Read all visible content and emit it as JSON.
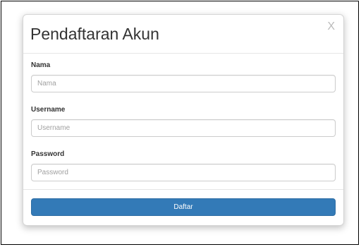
{
  "modal": {
    "title": "Pendaftaran Akun",
    "close_label": "X"
  },
  "form": {
    "fields": [
      {
        "label": "Nama",
        "placeholder": "Nama",
        "value": ""
      },
      {
        "label": "Username",
        "placeholder": "Username",
        "value": ""
      },
      {
        "label": "Password",
        "placeholder": "Password",
        "value": ""
      }
    ],
    "submit_label": "Daftar"
  },
  "colors": {
    "primary_button": "#337ab7",
    "title_text": "#333333",
    "placeholder_text": "#a0a0a0"
  }
}
